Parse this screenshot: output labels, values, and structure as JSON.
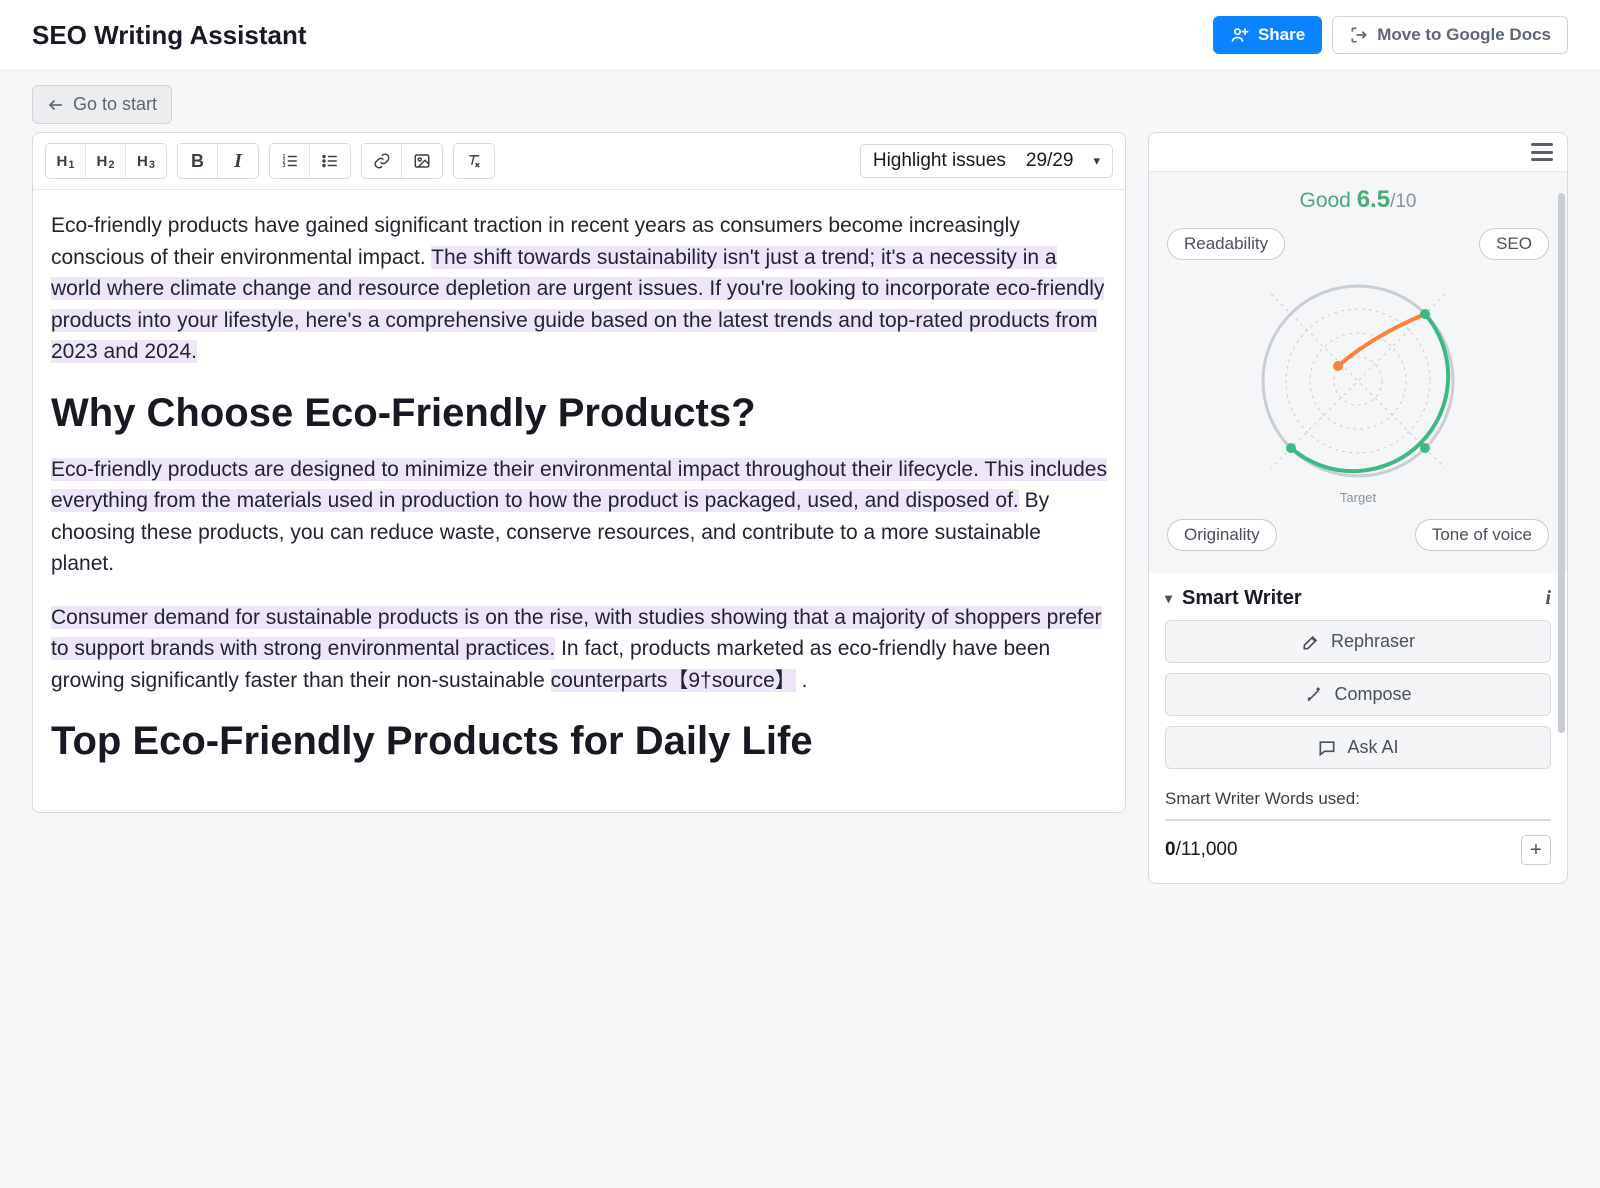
{
  "header": {
    "title": "SEO Writing Assistant",
    "share_label": "Share",
    "move_label": "Move to Google Docs"
  },
  "nav": {
    "go_start": "Go to start"
  },
  "toolbar": {
    "h1": "H",
    "h1s": "1",
    "h2": "H",
    "h2s": "2",
    "h3": "H",
    "h3s": "3",
    "bold": "B",
    "italic": "I",
    "highlight_label": "Highlight issues",
    "issues_count": "29/29"
  },
  "doc": {
    "p1a": "Eco-friendly products have gained significant traction in recent years as consumers become increasingly conscious of their environmental impact. ",
    "p1b": "The shift towards sustainability isn't just a trend; it's a necessity in a world where climate change and resource depletion are urgent issues.",
    "p1c": " If you're looking to incorporate eco-friendly products into your lifestyle, here's a comprehensive guide based on the latest trends and top-rated products from 2023 and 2024.",
    "h2a": "Why Choose Eco-Friendly Products?",
    "p2a": "Eco-friendly products are designed to minimize their environmental impact throughout their lifecycle.",
    "p2b": " This includes everything from the materials used in production to how the product is packaged, used, and disposed of.",
    "p2c": " By choosing these products, you can reduce waste, conserve resources, and contribute to a more sustainable planet.",
    "p3a": "Consumer demand for sustainable products is on the rise, with studies showing that a majority of shoppers prefer to support brands with strong environmental practices.",
    "p3b": " In fact, products marketed as eco-friendly have been growing significantly faster than their non-sustainable ",
    "p3c": "counterparts【9†source】",
    "p3d": " .",
    "h2b": "Top Eco-Friendly Products for Daily Life"
  },
  "score": {
    "label": "Good",
    "value": "6.5",
    "max": "/10",
    "target": "Target",
    "pills": {
      "readability": "Readability",
      "seo": "SEO",
      "originality": "Originality",
      "tone": "Tone of voice"
    }
  },
  "smart_writer": {
    "title": "Smart Writer",
    "rephraser": "Rephraser",
    "compose": "Compose",
    "ask_ai": "Ask AI",
    "usage_label": "Smart Writer Words used:",
    "used": "0",
    "total": "/11,000"
  }
}
